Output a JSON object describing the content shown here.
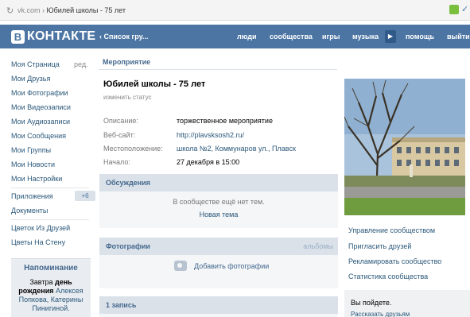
{
  "browser": {
    "domain": "vk.com",
    "separator": "›",
    "page_title": "Юбилей школы - 75 лет"
  },
  "header": {
    "logo_letter": "В",
    "logo_text": "КОНТАКТЕ",
    "back_label": "‹ Список гру...",
    "nav": [
      "люди",
      "сообщества",
      "игры",
      "музыка",
      "помощь",
      "выйти"
    ]
  },
  "sidebar": {
    "items": [
      "Моя Страница",
      "Мои Друзья",
      "Мои Фотографии",
      "Мои Видеозаписи",
      "Мои Аудиозаписи",
      "Мои Сообщения",
      "Мои Группы",
      "Мои Новости",
      "Мои Настройки"
    ],
    "edit_label": "ред.",
    "apps_label": "Приложения",
    "apps_badge": "+6",
    "docs_label": "Документы",
    "extra": [
      "Цветок Из Друзей",
      "Цветы На Стену"
    ]
  },
  "reminder": {
    "title": "Напоминание",
    "pre": "Завтра ",
    "bold": "день рождения ",
    "names": "Алексея Попкова, Катерины Пинигиной."
  },
  "group": {
    "breadcrumb": "Мероприятие",
    "name": "Юбилей школы - 75 лет",
    "status_link": "изменить статус",
    "info": [
      {
        "key": "Описание:",
        "value": "торжественное мероприятие"
      },
      {
        "key": "Веб-сайт:",
        "value": "http://plavsksosh2.ru/"
      },
      {
        "key": "Местоположение:",
        "value": "школа №2, Коммунаров ул., Плавск"
      },
      {
        "key": "Начало:",
        "value": "27 декабря в 15:00"
      }
    ]
  },
  "discussions": {
    "title": "Обсуждения",
    "empty": "В сообществе ещё нет тем.",
    "new_topic": "Новая тема"
  },
  "photos": {
    "title": "Фотографии",
    "albums": "альбомы",
    "add": "Добавить фотографии"
  },
  "wall": {
    "title": "1 запись"
  },
  "right": {
    "links": [
      "Управление сообществом",
      "Пригласить друзей",
      "Рекламировать сообщество",
      "Статистика сообщества"
    ],
    "question": "Вы пойдете.",
    "share": "Рассказать друзьям"
  },
  "colors": {
    "header_bg": "#4c75a3",
    "link": "#2b587a",
    "section_bg": "#dae1e8"
  }
}
